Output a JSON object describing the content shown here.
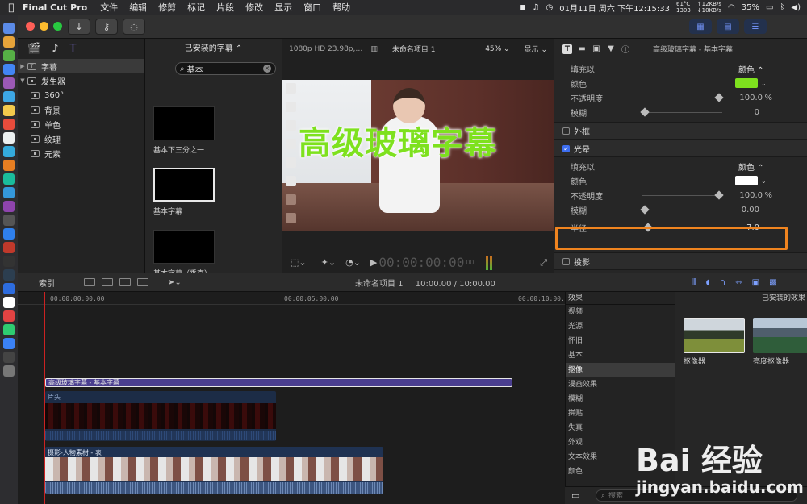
{
  "menubar": {
    "app_name": "Final Cut Pro",
    "items": [
      "文件",
      "编辑",
      "修剪",
      "标记",
      "片段",
      "修改",
      "显示",
      "窗口",
      "帮助"
    ],
    "temp": "61°C",
    "fan": "1303",
    "net_up": "↑12KB/s",
    "net_down": "↓10KB/s",
    "datetime": "01月11日 周六 下午12:15:33",
    "battery": "35%"
  },
  "library": {
    "items": [
      {
        "label": "字幕",
        "level": 0,
        "expanded": false,
        "selected": true
      },
      {
        "label": "发生器",
        "level": 0,
        "expanded": true,
        "selected": false
      },
      {
        "label": "360°",
        "level": 1
      },
      {
        "label": "背景",
        "level": 1
      },
      {
        "label": "单色",
        "level": 1
      },
      {
        "label": "纹理",
        "level": 1
      },
      {
        "label": "元素",
        "level": 1
      }
    ]
  },
  "browser": {
    "header": "已安装的字幕 ⌃",
    "search_value": "基本",
    "items": [
      {
        "label": "基本下三分之一"
      },
      {
        "label": "基本字幕"
      },
      {
        "label": "基本字幕（垂直）"
      }
    ]
  },
  "viewer": {
    "format": "1080p HD 23.98p,…",
    "project": "未命名项目 1",
    "zoom": "45% ⌄",
    "display": "显示 ⌄",
    "overlay_title": "高级玻璃字幕",
    "timecode": "00:00:00:00",
    "timecode_frames": "00"
  },
  "inspector": {
    "clip_name": "高级玻璃字幕 - 基本字幕",
    "face": {
      "fill_label": "填充以",
      "fill_value": "颜色 ⌃",
      "color_label": "颜色",
      "color_hex": "#7ee11e",
      "opacity_label": "不透明度",
      "opacity_value": "100.0",
      "opacity_unit": "%",
      "blur_label": "模糊",
      "blur_value": "0"
    },
    "outline_label": "外框",
    "glow_label": "光晕",
    "glow": {
      "fill_label": "填充以",
      "fill_value": "颜色 ⌃",
      "color_label": "颜色",
      "color_hex": "#ffffff",
      "opacity_label": "不透明度",
      "opacity_value": "100.0",
      "opacity_unit": "%",
      "blur_label": "模糊",
      "blur_value": "0.00",
      "radius_label": "半径",
      "radius_value": "7.0"
    },
    "shadow_label": "投影",
    "highlight_color": "#f0841f"
  },
  "timeline": {
    "index_label": "索引",
    "project": "未命名项目 1",
    "duration": "10:00.00 / 10:00.00",
    "ruler": [
      "00:00:00:00.00",
      "00:00:05:00.00",
      "00:00:10:00.0"
    ],
    "title_clip": "高级玻璃字幕 - 基本字幕",
    "clip_a": "片头",
    "clip_b": "摄影-人物素材 - 表"
  },
  "effects": {
    "header": "效果",
    "categories": [
      "视频",
      "光源",
      "怀旧",
      "基本",
      "抠像",
      "漫画效果",
      "模糊",
      "拼贴",
      "失真",
      "外观",
      "文本效果",
      "颜色"
    ],
    "selected_category": "抠像",
    "grid_header": "已安装的效果",
    "grid_items": [
      {
        "label": "抠像器"
      },
      {
        "label": "亮度抠像器"
      }
    ],
    "search_placeholder": "搜索"
  },
  "watermark": {
    "brand": "Bai 经验",
    "url": "jingyan.baidu.com"
  }
}
